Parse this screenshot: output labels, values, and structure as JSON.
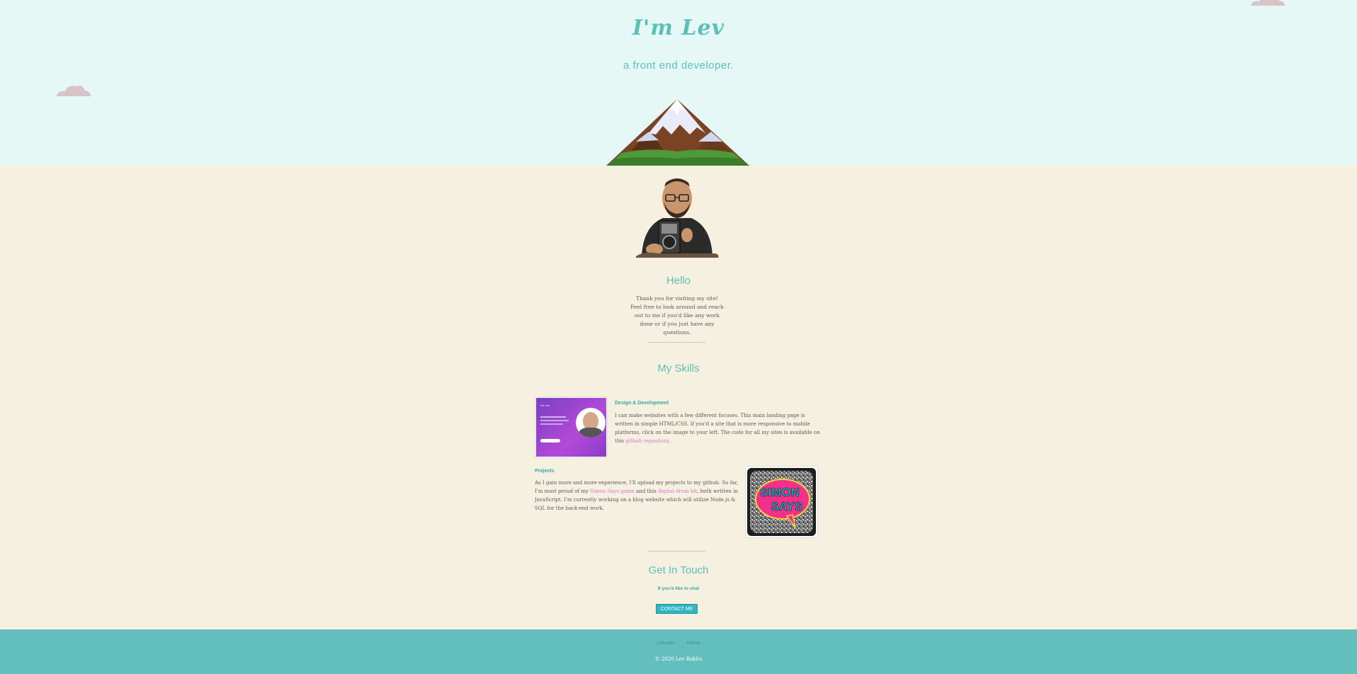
{
  "header": {
    "logo": "I'm Lev",
    "tagline": "a front end developer."
  },
  "hello": {
    "title": "Hello",
    "text": "Thank you for visiting my site! Feel free to look around and reach out to me if you'd like any work done or if you just have any questions."
  },
  "skills": {
    "title": "My Skills",
    "design": {
      "heading": "Design & Development",
      "text_before": "I can make websites with a few different focuses. This main landing page is written in simple HTML/CSS. If you'd a site that is more responsive to mobile platforms, click on the image to your left. The code for all my sites is available on this ",
      "link": "github repository",
      "text_after": ".",
      "thumb_title": "I'm Lev"
    },
    "projects": {
      "heading": "Projects",
      "text_1": "As I gain more and more experience, I'll upload my projects to my github. So far, I'm most proud of my ",
      "link_1": "Simon Says game",
      "text_2": " and this ",
      "link_2": "digital drum kit",
      "text_3": ", both written in JavaScript. I'm currently working on a blog website which will utilize Node.js & SQL for the back-end work.",
      "thumb_text_1": "SIMON",
      "thumb_text_2": "SAYS"
    }
  },
  "contact": {
    "title": "Get In Touch",
    "subtitle": "If you'd like to chat",
    "button": "CONTACT ME"
  },
  "footer": {
    "links": [
      "LinkedIn",
      "Github"
    ],
    "copyright": "© 2020 Lev Baklin"
  },
  "colors": {
    "accent": "#5cc0ba",
    "link": "#ea6fd3",
    "sky": "#e6f8f5",
    "body": "#f5f0df",
    "footer": "#63bfbd"
  }
}
